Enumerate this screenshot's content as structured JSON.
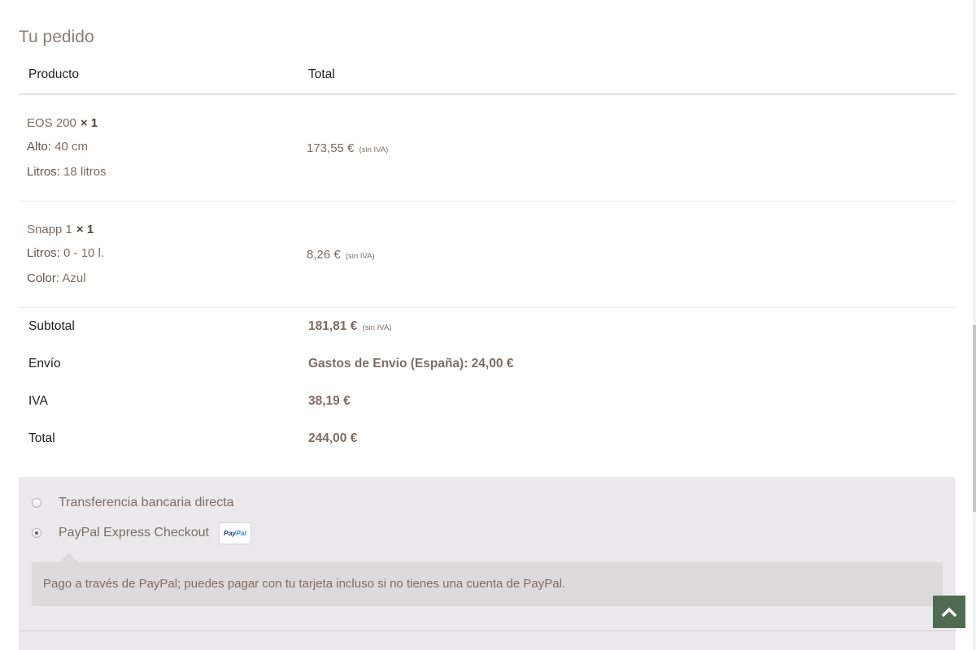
{
  "order": {
    "title": "Tu pedido",
    "headers": {
      "product": "Producto",
      "total": "Total"
    },
    "items": [
      {
        "name": "EOS 200",
        "qty": "× 1",
        "attrs": [
          {
            "label": "Alto:",
            "value": "40 cm"
          },
          {
            "label": "Litros:",
            "value": "18 litros"
          }
        ],
        "price": "173,55 €",
        "tax_note": "(sin IVA)"
      },
      {
        "name": "Snapp 1",
        "qty": "× 1",
        "attrs": [
          {
            "label": "Litros:",
            "value": "0 - 10 l."
          },
          {
            "label": "Color:",
            "value": "Azul"
          }
        ],
        "price": "8,26 €",
        "tax_note": "(sin IVA)"
      }
    ],
    "summary": {
      "subtotal": {
        "label": "Subtotal",
        "value": "181,81 €",
        "tax_note": "(sin IVA)"
      },
      "shipping": {
        "label": "Envío",
        "value": "Gastos de Envio (España): 24,00 €"
      },
      "tax": {
        "label": "IVA",
        "value": "38,19 €"
      },
      "total": {
        "label": "Total",
        "value": "244,00 €"
      }
    }
  },
  "payment": {
    "options": [
      {
        "label": "Transferencia bancaria directa",
        "selected": false
      },
      {
        "label": "PayPal Express Checkout",
        "selected": true,
        "badge": {
          "part1": "Pay",
          "part2": "Pal"
        }
      }
    ],
    "description": "Pago a través de PayPal; puedes pagar con tu tarjeta incluso si no tienes una cuenta de PayPal."
  },
  "icons": {
    "scroll_top": "chevron-up-icon",
    "radio": "radio-icon"
  },
  "colors": {
    "accent": "#4f6b52",
    "text": "#7a6e66",
    "heading": "#222222",
    "payment_bg": "#ebe9eb",
    "description_bg": "#dcdadb"
  }
}
